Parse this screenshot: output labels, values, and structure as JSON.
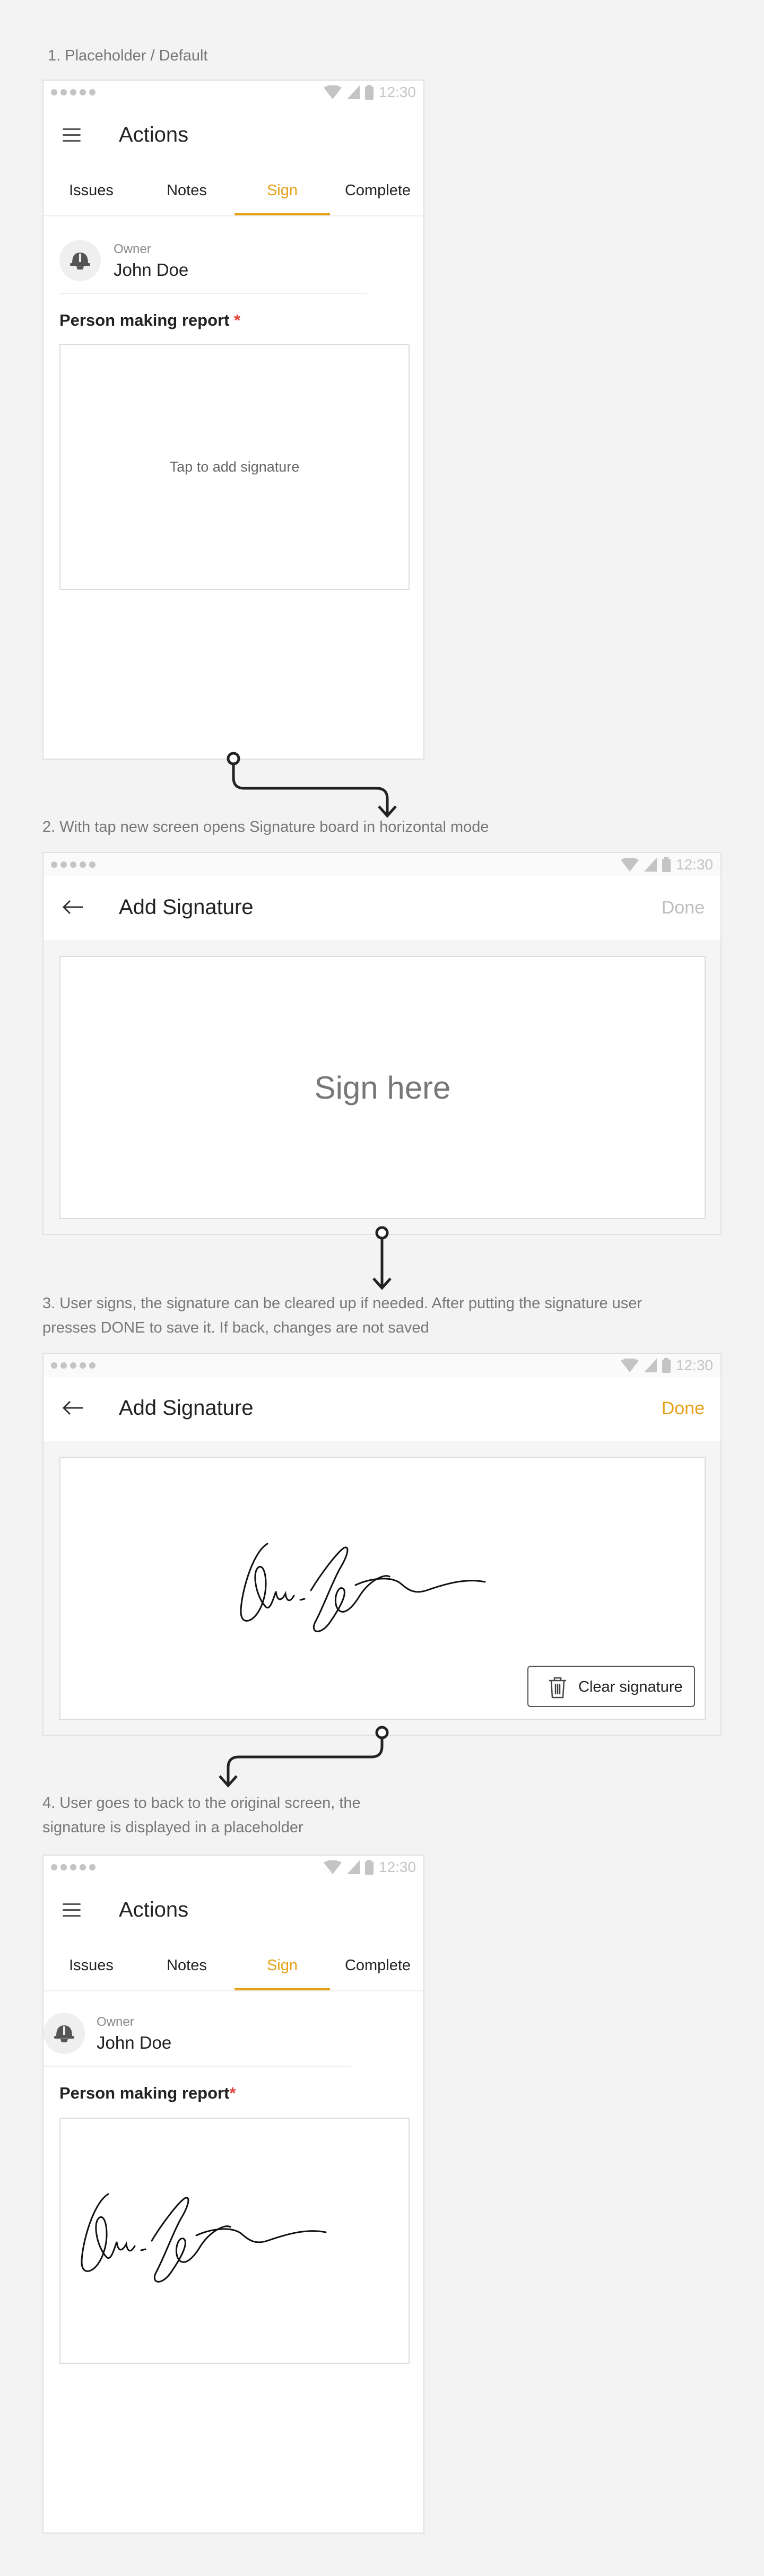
{
  "steps": {
    "s1": "1. Placeholder / Default",
    "s2": "2. With tap new screen opens Signature board in horizontal mode",
    "s3_line1": "3. User signs, the signature can be cleared up if needed. After putting the signature user",
    "s3_line2": "presses DONE to save it. If back, changes are not saved",
    "s4_line1": "4. User goes to back to the original screen, the",
    "s4_line2": "signature is displayed in a placeholder"
  },
  "status_bar": {
    "time": "12:30"
  },
  "actions_screen": {
    "title": "Actions",
    "tabs": [
      "Issues",
      "Notes",
      "Sign",
      "Complete"
    ],
    "active_tab": "Sign",
    "owner_label": "Owner",
    "owner_name": "John Doe",
    "field_label": "Person making report",
    "required_mark": "*",
    "placeholder": "Tap to add signature"
  },
  "signature_screen": {
    "title": "Add Signature",
    "done_label": "Done",
    "sign_here": "Sign here",
    "clear_label": "Clear signature"
  },
  "colors": {
    "accent": "#e5a11a",
    "done_disabled": "#bdbdbd",
    "required": "#e0423b"
  }
}
